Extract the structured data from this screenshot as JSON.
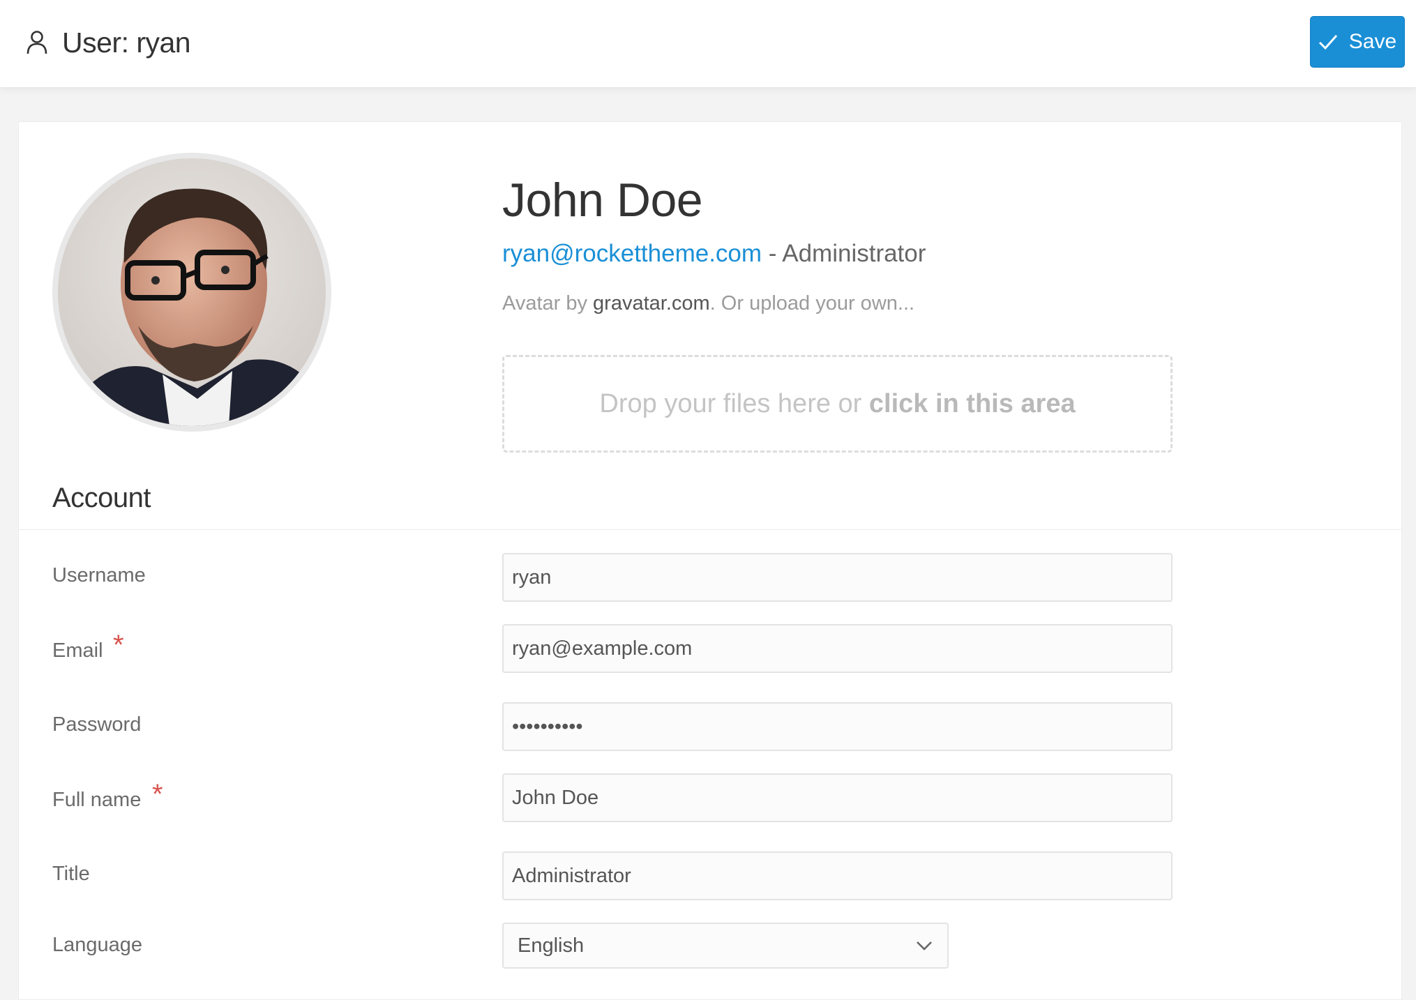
{
  "header": {
    "title": "User: ryan",
    "save_label": "Save",
    "icons": {
      "page": "user-icon",
      "save": "checkmark-icon"
    }
  },
  "profile": {
    "name": "John Doe",
    "email": "ryan@rockettheme.com",
    "separator": " - ",
    "role": "Administrator",
    "avatar_note": {
      "prefix": "Avatar by ",
      "service": "gravatar.com",
      "suffix": ". Or upload your own..."
    },
    "dropzone": {
      "text": "Drop your files here or ",
      "emphasis": "click in this area"
    }
  },
  "account": {
    "title": "Account",
    "fields": {
      "username": {
        "label": "Username",
        "value": "ryan"
      },
      "email": {
        "label": "Email",
        "value": "ryan@example.com",
        "required_mark": "*"
      },
      "password": {
        "label": "Password",
        "value": "••••••••••"
      },
      "fullname": {
        "label": "Full name",
        "value": "John Doe",
        "required_mark": "*"
      },
      "title": {
        "label": "Title",
        "value": "Administrator"
      },
      "language": {
        "label": "Language",
        "value": "English"
      }
    }
  },
  "colors": {
    "accent": "#1a8fd6",
    "required": "#d9534f",
    "background": "#f3f3f3"
  }
}
